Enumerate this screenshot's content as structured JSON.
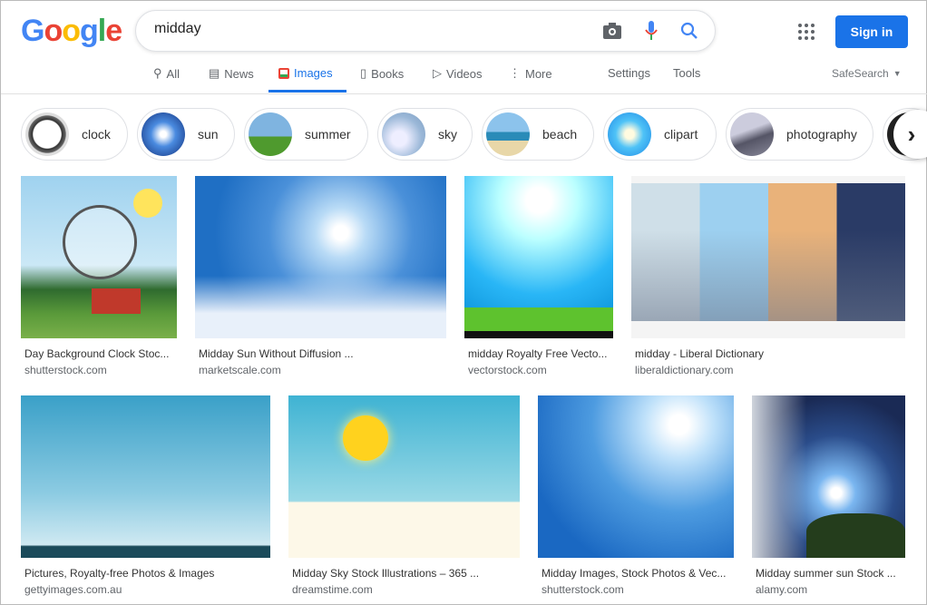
{
  "header": {
    "logo": "Google",
    "query": "midday",
    "sign_in": "Sign in"
  },
  "tabs": [
    {
      "label": "All",
      "icon": "search-icon"
    },
    {
      "label": "News",
      "icon": "news-icon"
    },
    {
      "label": "Images",
      "icon": "image-icon",
      "active": true
    },
    {
      "label": "Books",
      "icon": "book-icon"
    },
    {
      "label": "Videos",
      "icon": "video-icon"
    },
    {
      "label": "More",
      "icon": "more-vert-icon"
    }
  ],
  "tools": {
    "settings": "Settings",
    "tools": "Tools",
    "safesearch": "SafeSearch"
  },
  "chips": [
    "clock",
    "sun",
    "summer",
    "sky",
    "beach",
    "clipart",
    "photography"
  ],
  "results": [
    {
      "title": "Day Background Clock Stoc...",
      "source": "shutterstock.com"
    },
    {
      "title": "Midday Sun Without Diffusion ...",
      "source": "marketscale.com"
    },
    {
      "title": "midday Royalty Free Vecto...",
      "source": "vectorstock.com"
    },
    {
      "title": "midday - Liberal Dictionary",
      "source": "liberaldictionary.com"
    },
    {
      "title": "Pictures, Royalty-free Photos & Images",
      "source": "gettyimages.com.au"
    },
    {
      "title": "Midday Sky Stock Illustrations – 365 ...",
      "source": "dreamstime.com"
    },
    {
      "title": "Midday Images, Stock Photos & Vec...",
      "source": "shutterstock.com"
    },
    {
      "title": "Midday summer sun Stock ...",
      "source": "alamy.com"
    }
  ],
  "colors": {
    "accent": "#1a73e8"
  }
}
